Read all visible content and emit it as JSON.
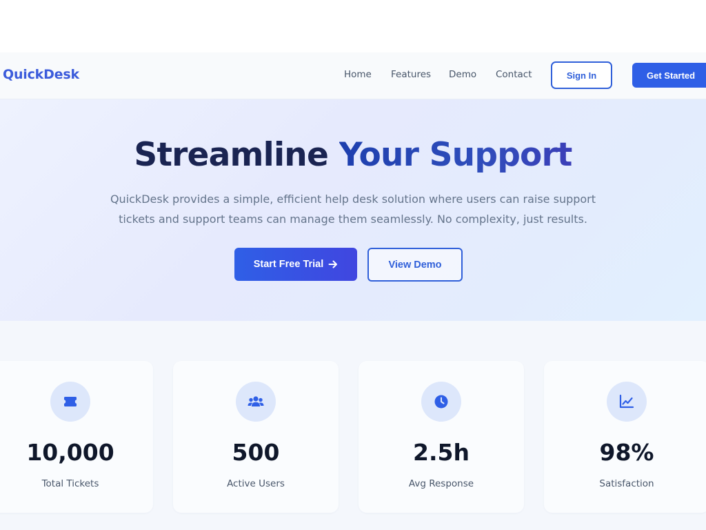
{
  "nav": {
    "logo": "QuickDesk",
    "links": [
      "Home",
      "Features",
      "Demo",
      "Contact"
    ],
    "sign_in": "Sign In",
    "get_started": "Get Started"
  },
  "hero": {
    "title_part1": "Streamline",
    "title_part2": "Your Support",
    "subtitle_line1": "QuickDesk provides a simple, efficient help desk solution where users can raise support",
    "subtitle_line2": "tickets and support teams can manage them seamlessly. No complexity, just results.",
    "primary_cta": "Start Free Trial",
    "secondary_cta": "View Demo"
  },
  "stats": [
    {
      "icon": "ticket-icon",
      "value": "10,000",
      "label": "Total Tickets"
    },
    {
      "icon": "users-icon",
      "value": "500",
      "label": "Active Users"
    },
    {
      "icon": "clock-icon",
      "value": "2.5h",
      "label": "Avg Response"
    },
    {
      "icon": "chart-line-icon",
      "value": "98%",
      "label": "Satisfaction"
    }
  ],
  "colors": {
    "brand": "#3b5bdb",
    "primary": "#2f5fe6",
    "heading": "#1a2452",
    "icon_bg": "#dde7fb"
  }
}
